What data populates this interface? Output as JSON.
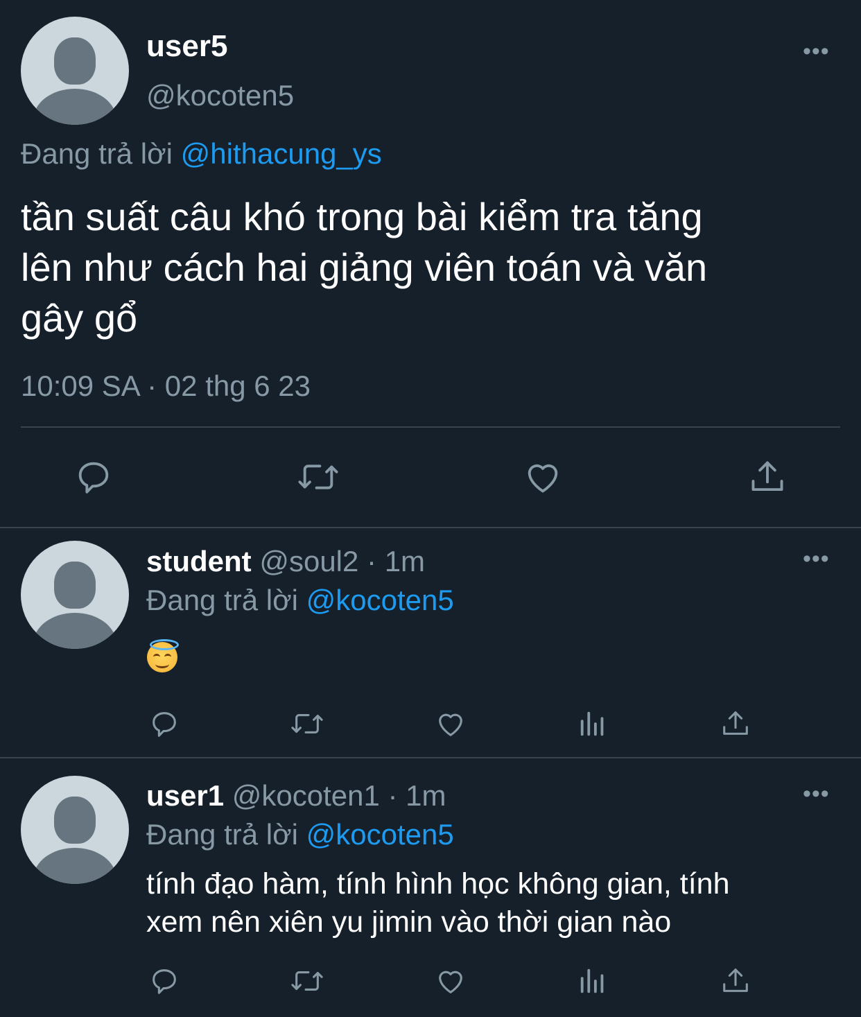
{
  "main_tweet": {
    "display_name": "user5",
    "handle": "@kocoten5",
    "reply_prefix": "Đang trả lời",
    "reply_to": "@hithacung_ys",
    "text_lines": [
      "tần suất câu khó trong bài kiểm tra tăng",
      "lên như cách hai giảng viên toán và văn",
      "gây gổ"
    ],
    "timestamp": "10:09 SA · 02 thg 6 23",
    "more_label": "•••"
  },
  "replies": [
    {
      "display_name": "student",
      "handle": "@soul2",
      "time": "· 1m",
      "reply_prefix": "Đang trả lời",
      "reply_to": "@kocoten5",
      "emoji": "smiling-face-with-halo",
      "text_lines": [],
      "more_label": "•••"
    },
    {
      "display_name": "user1",
      "handle": "@kocoten1",
      "time": "· 1m",
      "reply_prefix": "Đang trả lời",
      "reply_to": "@kocoten5",
      "text_lines": [
        "tính đạo hàm, tính hình học không gian, tính",
        "xem nên xiên yu jimin vào thời gian nào"
      ],
      "more_label": "•••"
    }
  ],
  "colors": {
    "background": "#15202b",
    "text": "#ffffff",
    "secondary": "#8899a6",
    "link": "#1d9bf0",
    "divider": "#38444d",
    "avatar_bg": "#ccd6dd",
    "avatar_fg": "#66757f"
  },
  "icons": [
    "reply-icon",
    "retweet-icon",
    "like-icon",
    "share-icon",
    "views-icon",
    "more-icon"
  ]
}
